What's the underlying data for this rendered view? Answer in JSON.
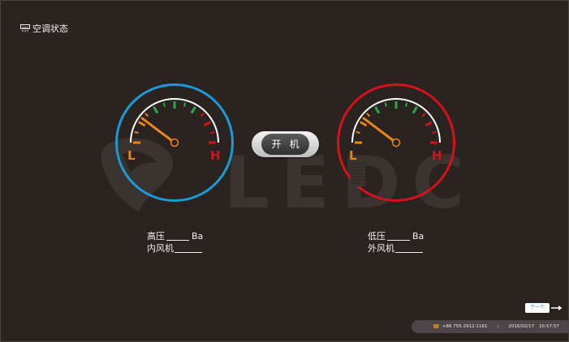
{
  "header": {
    "title": "空调状态",
    "icon": "ac-unit-icon"
  },
  "watermark": {
    "text": "LEDC"
  },
  "gauges": {
    "left": {
      "low_label": "L",
      "high_label": "H",
      "ring_color": "#1a9ad6"
    },
    "right": {
      "low_label": "L",
      "high_label": "H",
      "ring_color": "#d5121c"
    }
  },
  "colors": {
    "low_zone": "#e8861c",
    "mid_zone": "#2aa84a",
    "high_zone": "#d5121c",
    "needle": "#e8861c",
    "background": "#2a2320"
  },
  "power_button": {
    "label": "开机"
  },
  "readings": {
    "left": {
      "pressure_label": "高压",
      "pressure_unit": "Ba",
      "fan_label": "内风机"
    },
    "right": {
      "pressure_label": "低压",
      "pressure_unit": "Ba",
      "fan_label": "外风机"
    }
  },
  "navigation": {
    "next_label": "下一个"
  },
  "status_bar": {
    "phone": "+86 755-2912-1161",
    "separator": "|",
    "date": "2016/02/17",
    "time": "10:57:57"
  }
}
